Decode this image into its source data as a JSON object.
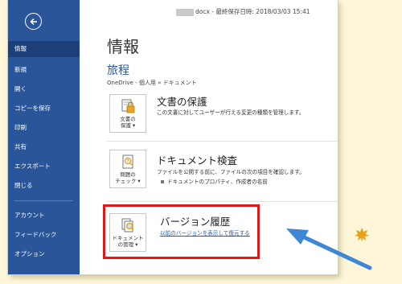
{
  "window": {
    "doc_title_suffix": "docx - 最終保存日時: 2018/03/03 15:41"
  },
  "sidebar": {
    "items": [
      {
        "label": "情報"
      },
      {
        "label": "新規"
      },
      {
        "label": "開く"
      },
      {
        "label": "コピーを保存"
      },
      {
        "label": "印刷"
      },
      {
        "label": "共有"
      },
      {
        "label": "エクスポート"
      },
      {
        "label": "閉じる"
      },
      {
        "label": "アカウント"
      },
      {
        "label": "フィードバック"
      },
      {
        "label": "オプション"
      }
    ]
  },
  "main": {
    "page_title": "情報",
    "doc_name": "旅程",
    "doc_path": "OneDrive - 個人用 » ドキュメント",
    "protect": {
      "tile_line1": "文書の",
      "tile_line2": "保護 ▾",
      "title": "文書の保護",
      "desc": "この文書に対してユーザーが行える変更の種類を管理します。"
    },
    "inspect": {
      "tile_line1": "問題の",
      "tile_line2": "チェック ▾",
      "title": "ドキュメント検査",
      "desc1": "ファイルを公開する前に、ファイルの次の項目を確認します。",
      "desc2": "ドキュメントのプロパティ、作成者の名前"
    },
    "version": {
      "tile_line1": "ドキュメント",
      "tile_line2": "の管理 ▾",
      "title": "バージョン履歴",
      "link": "以前のバージョンを表示して復元する"
    }
  },
  "icons": {
    "back": "back-arrow-icon",
    "lock": "lock-icon",
    "inspect": "document-check-icon",
    "manage": "document-manage-icon"
  },
  "colors": {
    "sidebar": "#2a5699",
    "sidebar_active": "#1c3f78",
    "highlight": "#e01818",
    "arrow": "#3f86d6",
    "background": "#fdf6d9"
  }
}
